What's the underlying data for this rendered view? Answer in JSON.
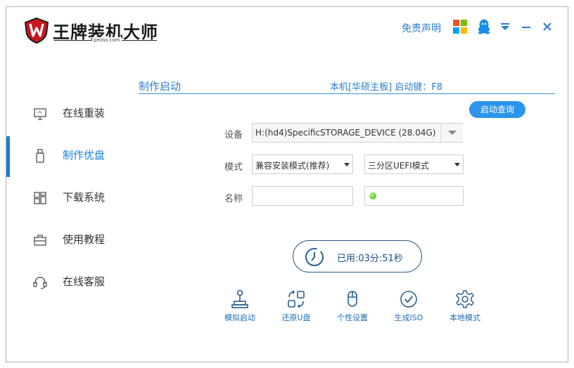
{
  "app": {
    "brand_name": "王牌装机大师",
    "brand_sub": "peoss.com"
  },
  "titlebar": {
    "disclaimer": "免责声明"
  },
  "sidebar": {
    "items": [
      {
        "label": "在线重装",
        "icon": "monitor-icon"
      },
      {
        "label": "制作优盘",
        "icon": "usb-drive-icon",
        "active": true
      },
      {
        "label": "下载系统",
        "icon": "grid-icon"
      },
      {
        "label": "使用教程",
        "icon": "briefcase-icon"
      },
      {
        "label": "在线客服",
        "icon": "headset-icon"
      }
    ]
  },
  "main": {
    "section_title": "制作启动",
    "board_info": "本机[华硕主板]  启动键：F8",
    "query_button": "启动查询",
    "device_label": "设备",
    "device_value": "H:(hd4)SpecificSTORAGE_DEVICE (28.04G)",
    "mode_label": "模式",
    "mode_value": "兼容安装模式(推荐)",
    "partition_value": "三分区UEFI模式",
    "name_label": "名称",
    "name_value": "",
    "timer_text": "已用:03分:51秒"
  },
  "tools": [
    {
      "label": "模拟启动",
      "icon": "joystick-icon"
    },
    {
      "label": "还原U盘",
      "icon": "restore-icon"
    },
    {
      "label": "个性设置",
      "icon": "mouse-icon"
    },
    {
      "label": "生成ISO",
      "icon": "check-circle-icon"
    },
    {
      "label": "本地模式",
      "icon": "gear-icon"
    }
  ],
  "colors": {
    "accent": "#1a7fd6",
    "button": "#2c95ea",
    "status_green": "#45b51a",
    "logo_red": "#c8171e"
  }
}
